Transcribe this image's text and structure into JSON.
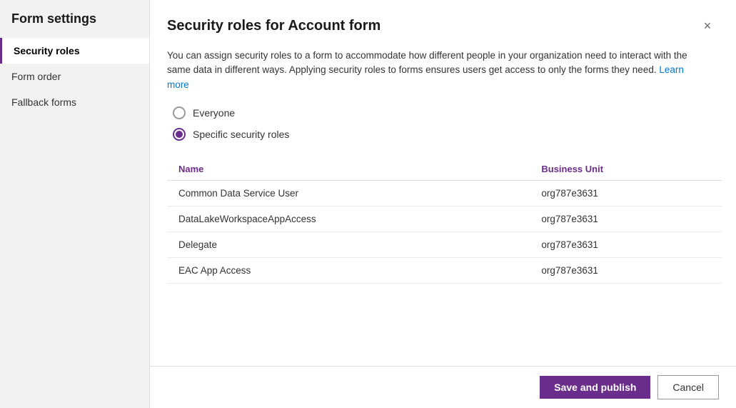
{
  "sidebar": {
    "title": "Form settings",
    "items": [
      {
        "id": "security-roles",
        "label": "Security roles",
        "active": true
      },
      {
        "id": "form-order",
        "label": "Form order",
        "active": false
      },
      {
        "id": "fallback-forms",
        "label": "Fallback forms",
        "active": false
      }
    ]
  },
  "dialog": {
    "title": "Security roles for Account form",
    "close_label": "×",
    "description_part1": "You can assign security roles to a form to accommodate how different people in your organization need to interact with the same data in different ways. Applying security roles to forms ensures users get access to only the forms they need.",
    "learn_more_label": "Learn more",
    "radio_options": [
      {
        "id": "everyone",
        "label": "Everyone",
        "selected": false
      },
      {
        "id": "specific",
        "label": "Specific security roles",
        "selected": true
      }
    ],
    "table": {
      "columns": [
        {
          "id": "name",
          "label": "Name"
        },
        {
          "id": "business_unit",
          "label": "Business Unit"
        }
      ],
      "rows": [
        {
          "name": "Common Data Service User",
          "business_unit": "org787e3631"
        },
        {
          "name": "DataLakeWorkspaceAppAccess",
          "business_unit": "org787e3631"
        },
        {
          "name": "Delegate",
          "business_unit": "org787e3631"
        },
        {
          "name": "EAC App Access",
          "business_unit": "org787e3631"
        }
      ]
    }
  },
  "footer": {
    "save_label": "Save and publish",
    "cancel_label": "Cancel"
  }
}
